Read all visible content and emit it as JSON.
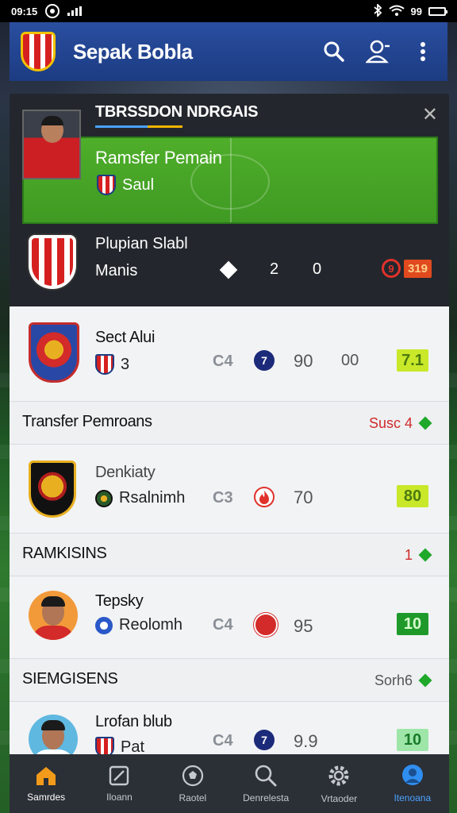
{
  "status_bar": {
    "time": "09:15",
    "battery": "99"
  },
  "app": {
    "title": "Sepak Bobla"
  },
  "hero": {
    "title": "TBRSSDON NDRGAIS",
    "banner_title": "Ramsfer Pemain",
    "banner_club": "Saul",
    "match_title": "Plupian Slabl",
    "match_sub": "Manis",
    "score_home": "2",
    "score_away": "0",
    "live_ring": "9",
    "live_tag": "319"
  },
  "rows": [
    {
      "name": "Sect Alui",
      "sub": "3",
      "code": "C4",
      "circle": "7",
      "value": "90",
      "value2": "00",
      "rating": "7.1"
    },
    {
      "name": "Denkiaty",
      "sub": "Rsalnimh",
      "code": "C3",
      "value": "70",
      "rating": "80"
    },
    {
      "name": "Tepsky",
      "sub": "Reolomh",
      "code": "C4",
      "value": "95",
      "rating": "10"
    },
    {
      "name": "Lrofan blub",
      "sub": "Pat",
      "code": "C4",
      "circle": "7",
      "value": "9.9",
      "rating": "10"
    }
  ],
  "sections": [
    {
      "title": "Transfer Pemroans",
      "right": "Susc 4"
    },
    {
      "title": "RAMKISINS",
      "right": "1"
    },
    {
      "title": "SIEMGISENS",
      "right": "Sorh6"
    }
  ],
  "nav": [
    {
      "label": "Samrdes",
      "icon": "home-icon"
    },
    {
      "label": "Iloann",
      "icon": "edit-icon"
    },
    {
      "label": "Raotel",
      "icon": "soccer-ball-icon"
    },
    {
      "label": "Denrelesta",
      "icon": "search-icon"
    },
    {
      "label": "Vrtaoder",
      "icon": "settings-icon"
    },
    {
      "label": "Itenoana",
      "icon": "profile-icon"
    }
  ],
  "colors": {
    "appbar": "#1c3b82",
    "accent_green": "#1fa82a",
    "rating_lime": "#c9e82a",
    "live_red": "#e0322a"
  }
}
